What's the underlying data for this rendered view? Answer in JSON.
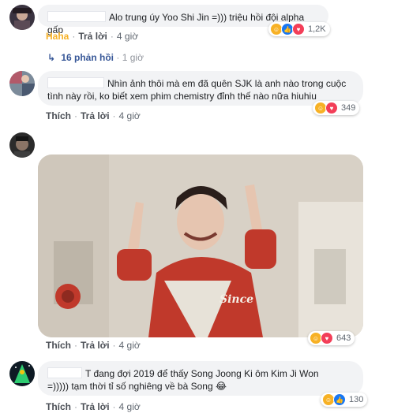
{
  "comments": [
    {
      "text": "Alo trung úy Yoo Shi Jin =))) triệu hồi đội alpha gấp",
      "reaction_action": "Haha",
      "reply": "Trả lời",
      "time": "4 giờ",
      "reaction_count": "1,2K",
      "replies_label": "16 phản hồi",
      "replies_time": "1 giờ"
    },
    {
      "text_line1": "Nhìn ảnh thôi mà em đã quên SJK là anh nào trong cuộc",
      "text_line2": "tình này rồi, ko biết xem phim chemistry đỉnh thế nào nữa hiuhiu",
      "reaction_action": "Thích",
      "reply": "Trả lời",
      "time": "4 giờ",
      "reaction_count": "349"
    },
    {
      "reaction_action": "Thích",
      "reply": "Trả lời",
      "time": "4 giờ",
      "reaction_count": "643",
      "gif_text": "Since"
    },
    {
      "text_line1": "T đang đợi 2019 để thấy Song Joong Ki ôm Kim Ji Won",
      "text_line2": "=))))) tạm thời tỉ số nghiêng về bà Song 😂",
      "reaction_action": "Thích",
      "reply": "Trả lời",
      "time": "4 giờ",
      "reaction_count": "130"
    }
  ],
  "icons": {
    "haha": "haha-reaction-icon",
    "like": "like-reaction-icon",
    "love": "love-reaction-icon"
  },
  "colors": {
    "link": "#385898",
    "haha": "#f7b125",
    "like": "#1877f2",
    "love": "#f33e58",
    "bubble": "#f2f3f5"
  }
}
